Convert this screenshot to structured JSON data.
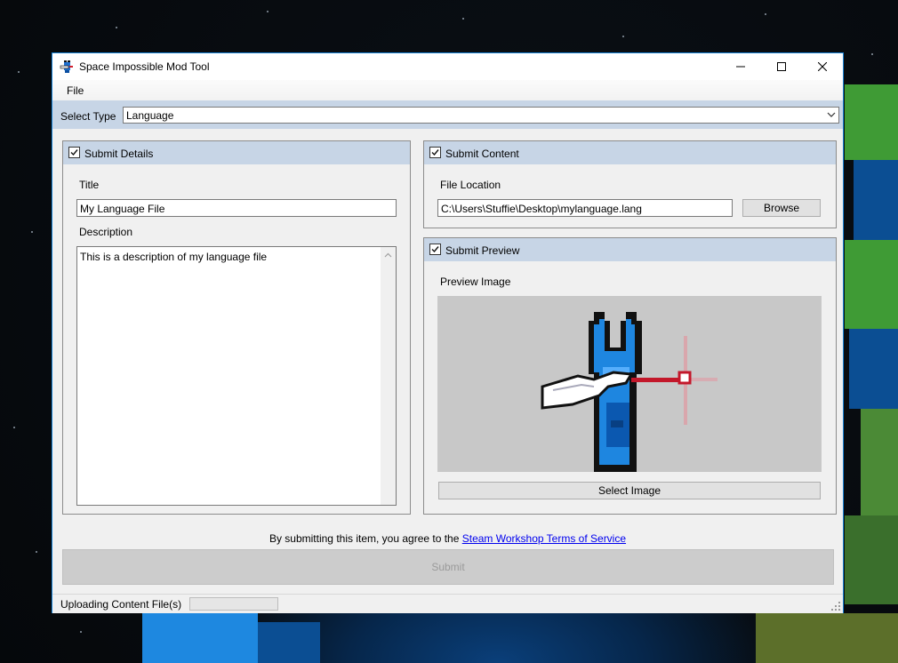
{
  "window": {
    "title": "Space Impossible Mod Tool",
    "accent_color": "#1883d7",
    "controls": [
      "minimize-icon",
      "maximize-icon",
      "close-icon"
    ]
  },
  "menu": {
    "items": [
      "File"
    ]
  },
  "type_selector": {
    "label": "Select Type",
    "selected": "Language"
  },
  "submit_details": {
    "checkbox_label": "Submit Details",
    "checked": true,
    "title_label": "Title",
    "title_value": "My Language File",
    "description_label": "Description",
    "description_value": "This is a description of my language file"
  },
  "submit_content": {
    "checkbox_label": "Submit Content",
    "checked": true,
    "file_location_label": "File Location",
    "file_location_value": "C:\\Users\\Stuffie\\Desktop\\mylanguage.lang",
    "browse_label": "Browse"
  },
  "submit_preview": {
    "checkbox_label": "Submit Preview",
    "checked": true,
    "preview_label": "Preview Image",
    "preview_icon": "wrench-laser-icon",
    "select_image_label": "Select Image"
  },
  "agreement": {
    "text": "By submitting this item, you agree to the ",
    "link_text": "Steam Workshop Terms of Service"
  },
  "submit_button": {
    "label": "Submit",
    "enabled": false
  },
  "status": {
    "text": "Uploading Content File(s)",
    "progress": 0
  }
}
